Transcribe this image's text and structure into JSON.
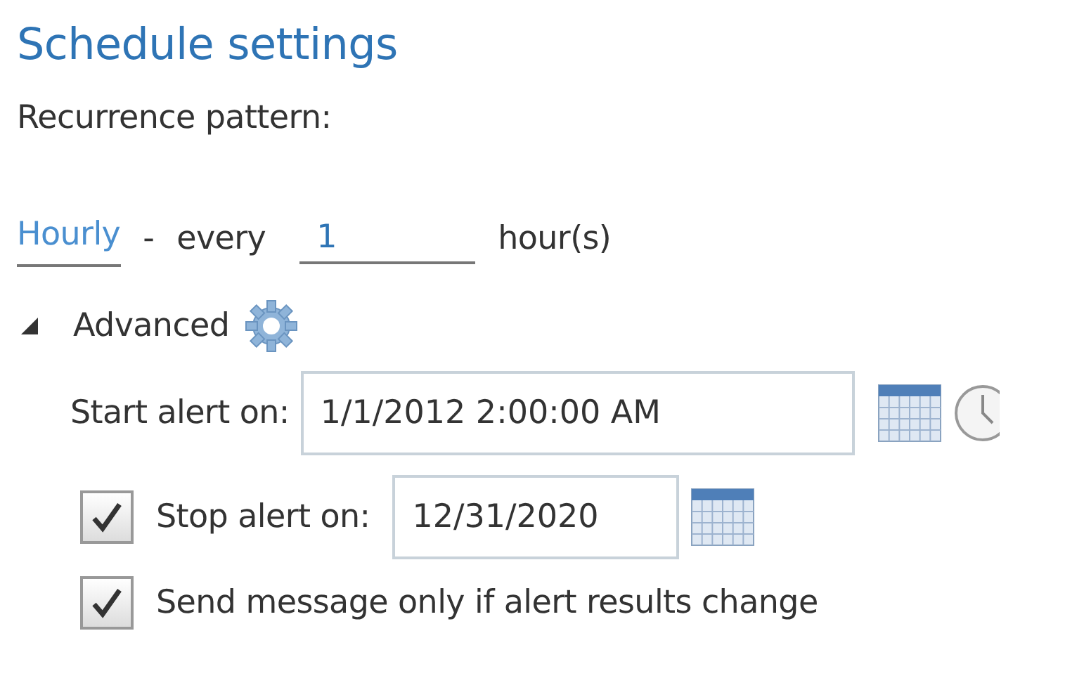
{
  "title": "Schedule settings",
  "recurrence_label": "Recurrence pattern:",
  "frequency": {
    "value": "Hourly",
    "separator": "-",
    "every_label": "every",
    "interval": "1",
    "unit": "hour(s)"
  },
  "advanced": {
    "label": "Advanced",
    "expanded": true
  },
  "start": {
    "label": "Start alert on:",
    "value": "1/1/2012 2:00:00 AM"
  },
  "stop": {
    "checked": true,
    "label": "Stop alert on:",
    "value": "12/31/2020"
  },
  "send_only_on_change": {
    "checked": true,
    "label": "Send message only if alert results change"
  }
}
